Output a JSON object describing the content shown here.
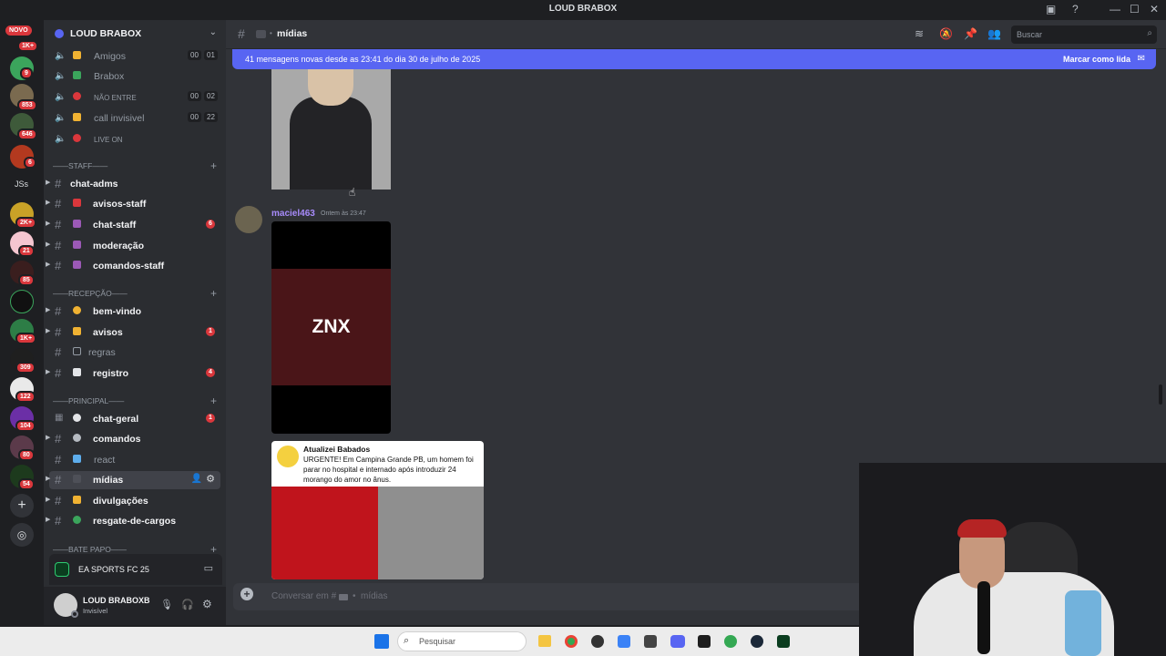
{
  "window": {
    "title": "LOUD BRABOX"
  },
  "rail": {
    "novo_label": "NOVO",
    "js_label": "JSs",
    "badges": [
      "1K+",
      "9",
      "853",
      "646",
      "6",
      "2K+",
      "21",
      "85",
      "1K+",
      "309",
      "122",
      "104",
      "80",
      "54"
    ]
  },
  "server": {
    "name": "LOUD BRABOX"
  },
  "voice_channels": [
    {
      "name": "Amigos",
      "left": "00",
      "right": "01"
    },
    {
      "name": "Brabox"
    },
    {
      "name": "NÃO ENTRE",
      "left": "00",
      "right": "02"
    },
    {
      "name": "call invisivel",
      "left": "00",
      "right": "22"
    },
    {
      "name": "LIVE ON"
    }
  ],
  "categories": {
    "staff": "——STAFF——",
    "recepcao": "——RECEPÇÃO——",
    "principal": "——PRINCIPAL——",
    "bate_papo": "——BATE PAPO——"
  },
  "channels": {
    "chat_adms": "chat-adms",
    "avisos_staff": "avisos-staff",
    "chat_staff": "chat-staff",
    "chat_staff_badge": "6",
    "moderacao": "moderação",
    "comandos_staff": "comandos-staff",
    "bem_vindo": "bem-vindo",
    "avisos": "avisos",
    "avisos_badge": "1",
    "regras": "regras",
    "registro": "registro",
    "registro_badge": "4",
    "chat_geral": "chat-geral",
    "chat_geral_badge": "1",
    "comandos": "comandos",
    "react": "react",
    "midias": "mídias",
    "divulgacoes": "divulgações",
    "resgate": "resgate-de-cargos"
  },
  "activity": {
    "game": "EA SPORTS FC 25"
  },
  "user": {
    "name": "LOUD BRABOXB",
    "status": "Invisível"
  },
  "header": {
    "channel": "mídias",
    "search_placeholder": "Buscar"
  },
  "newbar": {
    "text": "41 mensagens novas desde as 23:41 do dia 30 de julho de 2025",
    "action": "Marcar como lida"
  },
  "message": {
    "author": "maciel463",
    "timestamp": "Ontem às 23:47",
    "video_text": "ZNX",
    "embed_source": "Atualizei Babados",
    "embed_text": "URGENTE! Em Campina Grande PB, um homem foi parar no hospital e internado após introduzir 24 morango do amor no ânus."
  },
  "composer": {
    "placeholder": "Conversar em #",
    "placeholder_channel": "mídias"
  },
  "taskbar": {
    "search": "Pesquisar"
  },
  "colors": {
    "accent": "#5865f2",
    "badge": "#da373c",
    "author": "#a78bfa"
  }
}
